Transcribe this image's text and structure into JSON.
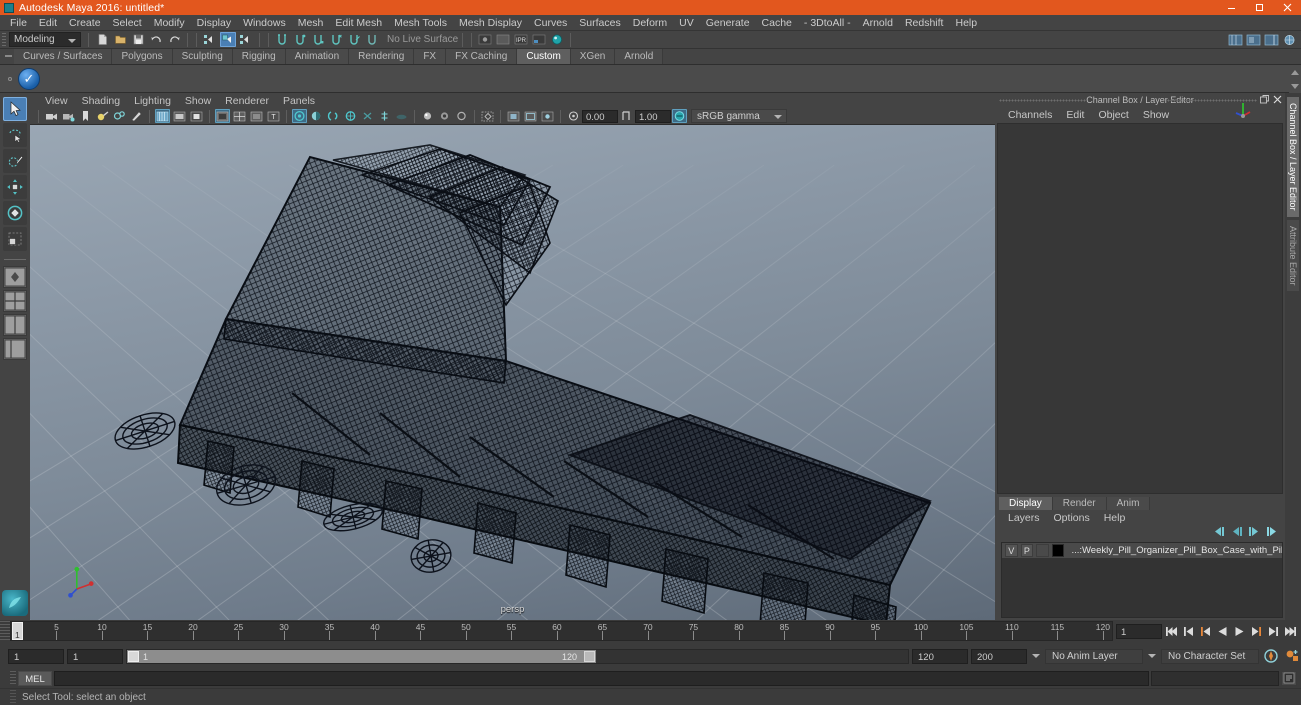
{
  "titlebar": {
    "title": "Autodesk Maya 2016: untitled*",
    "logo_icon": "maya-logo-icon",
    "minimize": "minimize-icon",
    "maximize": "maximize-icon",
    "close": "close-icon",
    "accent_color": "#e2571e"
  },
  "menubar": {
    "items": [
      {
        "label": "File"
      },
      {
        "label": "Edit"
      },
      {
        "label": "Create"
      },
      {
        "label": "Select"
      },
      {
        "label": "Modify"
      },
      {
        "label": "Display"
      },
      {
        "label": "Windows"
      },
      {
        "label": "Mesh"
      },
      {
        "label": "Edit Mesh"
      },
      {
        "label": "Mesh Tools"
      },
      {
        "label": "Mesh Display"
      },
      {
        "label": "Curves"
      },
      {
        "label": "Surfaces"
      },
      {
        "label": "Deform"
      },
      {
        "label": "UV"
      },
      {
        "label": "Generate"
      },
      {
        "label": "Cache"
      },
      {
        "label": "- 3DtoAll -"
      },
      {
        "label": "Arnold"
      },
      {
        "label": "Redshift"
      },
      {
        "label": "Help"
      }
    ]
  },
  "statusline": {
    "mode": "Modeling",
    "live_surface": "No Live Surface",
    "icons": [
      "new-scene-icon",
      "open-scene-icon",
      "save-scene-icon",
      "undo-icon",
      "redo-icon",
      "select-by-hierarchy-icon",
      "select-by-object-icon",
      "select-by-component-icon",
      "snap-to-grid-icon",
      "snap-to-curve-icon",
      "snap-to-point-icon",
      "snap-to-projected-center-icon",
      "snap-to-view-plane-icon",
      "make-live-icon"
    ],
    "render_icons": [
      "render-current-frame-icon",
      "ipr-render-icon",
      "render-settings-icon",
      "hypershade-icon",
      "render-view-icon"
    ],
    "right_icons": [
      "show-hide-modeling-toolkit-icon",
      "show-hide-attribute-editor-icon",
      "show-hide-tool-settings-icon",
      "show-hide-channel-box-icon"
    ]
  },
  "shelf": {
    "tabs": [
      {
        "label": "Curves / Surfaces",
        "active": false
      },
      {
        "label": "Polygons",
        "active": false
      },
      {
        "label": "Sculpting",
        "active": false
      },
      {
        "label": "Rigging",
        "active": false
      },
      {
        "label": "Animation",
        "active": false
      },
      {
        "label": "Rendering",
        "active": false
      },
      {
        "label": "FX",
        "active": false
      },
      {
        "label": "FX Caching",
        "active": false
      },
      {
        "label": "Custom",
        "active": true
      },
      {
        "label": "XGen",
        "active": false
      },
      {
        "label": "Arnold",
        "active": false
      }
    ],
    "button_icon": "blue-checkmark-shelf-icon"
  },
  "toolbox": {
    "tools": [
      {
        "name": "select-tool",
        "icon": "arrow-cursor-icon",
        "active": true
      },
      {
        "name": "lasso-tool",
        "icon": "lasso-select-icon",
        "active": false
      },
      {
        "name": "paint-select-tool",
        "icon": "paint-brush-icon",
        "active": false
      },
      {
        "name": "move-tool",
        "icon": "move-arrows-icon",
        "active": false
      },
      {
        "name": "rotate-tool",
        "icon": "rotate-ring-icon",
        "active": false
      },
      {
        "name": "scale-tool",
        "icon": "scale-box-icon",
        "active": false
      }
    ],
    "layouts": [
      {
        "name": "single-pane-layout",
        "icon": "single-perspective-icon"
      },
      {
        "name": "four-pane-layout",
        "icon": "four-view-icon"
      },
      {
        "name": "two-pane-side-layout",
        "icon": "two-pane-icon"
      },
      {
        "name": "persp-outliner-layout",
        "icon": "persp-outliner-icon"
      }
    ],
    "logo": "maya-paint-effects-icon"
  },
  "viewport": {
    "menus": [
      {
        "label": "View"
      },
      {
        "label": "Shading"
      },
      {
        "label": "Lighting"
      },
      {
        "label": "Show"
      },
      {
        "label": "Renderer"
      },
      {
        "label": "Panels"
      }
    ],
    "camera_label": "persp",
    "exposure": "0.00",
    "gamma_value": "1.00",
    "color_space": "sRGB gamma",
    "axis_gizmo": {
      "x_color": "#d03030",
      "y_color": "#2fbf2f",
      "z_color": "#3050d0"
    },
    "background_top": "#9aa7b4",
    "background_bottom": "#5e6a78",
    "wireframe_color": "#0c1018",
    "toolbar_icons": [
      "select-camera-icon",
      "lock-camera-icon",
      "bookmark-icon",
      "image-plane-icon",
      "two-d-pan-zoom-icon",
      "grease-pencil-icon",
      "wireframe-shading-icon",
      "smooth-shade-all-icon",
      "smooth-shade-selected-icon",
      "use-default-material-icon",
      "shaded-wireframe-icon",
      "textured-icon",
      "use-all-lights-icon",
      "shadows-icon",
      "screen-space-ao-icon",
      "motion-blur-icon",
      "multisample-aa-icon",
      "depth-of-field-icon",
      "isolate-select-icon",
      "xray-icon",
      "xray-joints-icon",
      "grid-toggle-icon",
      "film-gate-icon",
      "resolution-gate-icon",
      "exposure-icon",
      "gamma-icon",
      "view-transform-icon"
    ]
  },
  "channelbox": {
    "panel_title": "Channel Box / Layer Editor",
    "float_icon": "undock-panel-icon",
    "close_icon": "close-panel-icon",
    "menus": [
      {
        "label": "Channels"
      },
      {
        "label": "Edit"
      },
      {
        "label": "Object"
      },
      {
        "label": "Show"
      }
    ],
    "manipulator_icon": "axis-manipulator-icon",
    "vertical_tabs": [
      {
        "label": "Channel Box / Layer Editor",
        "active": true
      },
      {
        "label": "Attribute Editor",
        "active": false
      }
    ]
  },
  "layereditor": {
    "tabs": [
      {
        "label": "Display",
        "active": true
      },
      {
        "label": "Render",
        "active": false
      },
      {
        "label": "Anim",
        "active": false
      }
    ],
    "menus": [
      {
        "label": "Layers"
      },
      {
        "label": "Options"
      },
      {
        "label": "Help"
      }
    ],
    "toolbar_icons": [
      "move-layer-up-icon",
      "move-layer-down-icon",
      "create-empty-layer-icon",
      "create-layer-from-selected-icon"
    ],
    "layers": [
      {
        "visibility": "V",
        "playback": "P",
        "state": "",
        "color": "#000000",
        "name": "...:Weekly_Pill_Organizer_Pill_Box_Case_with_Pills"
      }
    ]
  },
  "timeslider": {
    "current_frame": "1",
    "frame_field": "1",
    "ticks": [
      {
        "value": "5"
      },
      {
        "value": "10"
      },
      {
        "value": "15"
      },
      {
        "value": "20"
      },
      {
        "value": "25"
      },
      {
        "value": "30"
      },
      {
        "value": "35"
      },
      {
        "value": "40"
      },
      {
        "value": "45"
      },
      {
        "value": "50"
      },
      {
        "value": "55"
      },
      {
        "value": "60"
      },
      {
        "value": "65"
      },
      {
        "value": "70"
      },
      {
        "value": "75"
      },
      {
        "value": "80"
      },
      {
        "value": "85"
      },
      {
        "value": "90"
      },
      {
        "value": "95"
      },
      {
        "value": "100"
      },
      {
        "value": "105"
      },
      {
        "value": "110"
      },
      {
        "value": "115"
      },
      {
        "value": "120"
      }
    ],
    "playback_buttons": [
      {
        "name": "go-to-start-button",
        "icon": "skip-to-start-icon"
      },
      {
        "name": "step-back-frame-button",
        "icon": "step-back-icon"
      },
      {
        "name": "previous-key-button",
        "icon": "previous-key-icon"
      },
      {
        "name": "play-backwards-button",
        "icon": "play-backward-icon"
      },
      {
        "name": "play-forwards-button",
        "icon": "play-forward-icon"
      },
      {
        "name": "next-key-button",
        "icon": "next-key-icon"
      },
      {
        "name": "step-forward-frame-button",
        "icon": "step-forward-icon"
      },
      {
        "name": "go-to-end-button",
        "icon": "skip-to-end-icon"
      }
    ]
  },
  "rangeslider": {
    "start_field": "1",
    "range_start_field": "1",
    "bar_start_label": "1",
    "bar_end_label": "120",
    "range_end_field": "120",
    "end_field": "200",
    "anim_layer": "No Anim Layer",
    "character_set": "No Character Set",
    "auto_key_icon": "auto-keyframe-icon",
    "anim_prefs_icon": "animation-preferences-icon"
  },
  "commandline": {
    "language": "MEL",
    "input_value": "",
    "input_placeholder": "",
    "script_editor_icon": "script-editor-icon"
  },
  "helpline": {
    "text": "Select Tool: select an object"
  }
}
